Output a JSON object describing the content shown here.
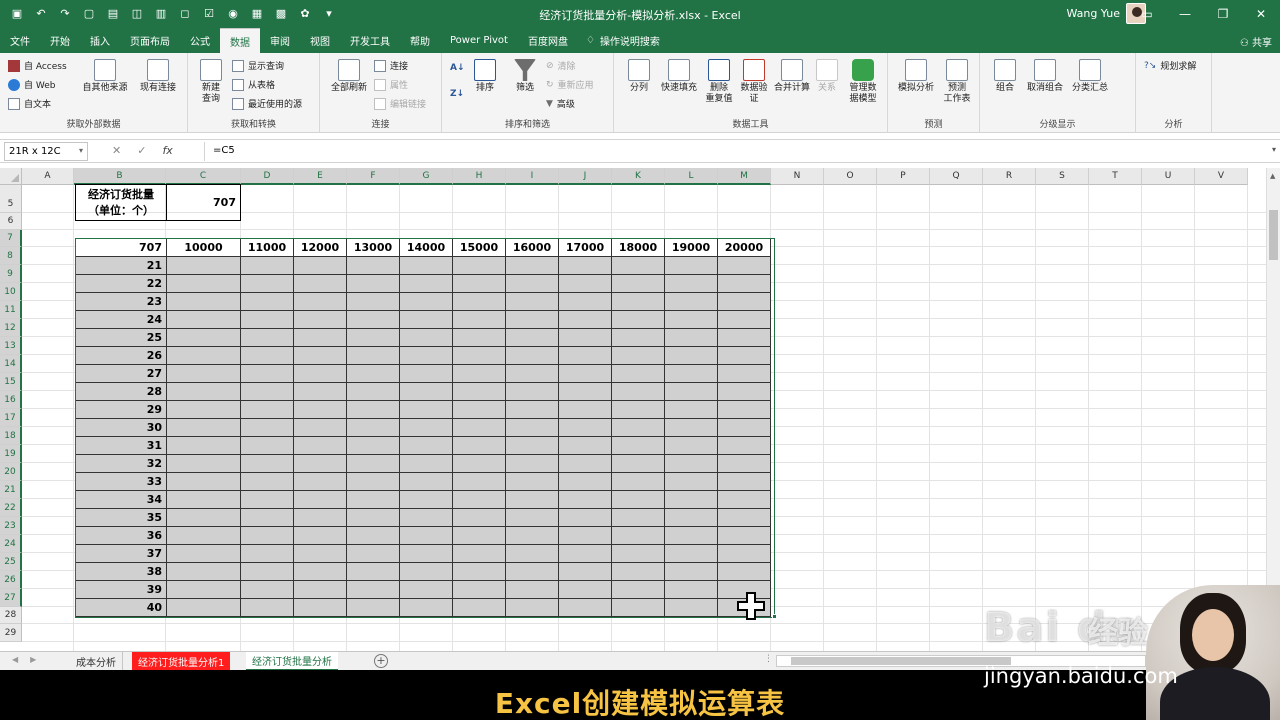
{
  "window": {
    "title": "经济订货批量分析-模拟分析.xlsx  -  Excel",
    "user": "Wang Yue"
  },
  "tabs": [
    "文件",
    "开始",
    "插入",
    "页面布局",
    "公式",
    "数据",
    "审阅",
    "视图",
    "开发工具",
    "帮助",
    "Power Pivot",
    "百度网盘"
  ],
  "active_tab": "数据",
  "tell_me": "操作说明搜索",
  "share": "共享",
  "ribbon": {
    "get_external": {
      "access": "自 Access",
      "web": "自 Web",
      "text": "自文本",
      "other": "自其他来源",
      "existing": "现有连接",
      "label": "获取外部数据"
    },
    "get_transform": {
      "new_query": "新建\n查询",
      "show_query": "显示查询",
      "from_table": "从表格",
      "recent": "最近使用的源",
      "label": "获取和转换"
    },
    "connections": {
      "refresh_all": "全部刷新",
      "connections": "连接",
      "properties": "属性",
      "edit_links": "编辑链接",
      "label": "连接"
    },
    "sort_filter": {
      "sort": "排序",
      "filter": "筛选",
      "clear": "清除",
      "reapply": "重新应用",
      "advanced": "高级",
      "label": "排序和筛选"
    },
    "data_tools": {
      "split": "分列",
      "flash_fill": "快速填充",
      "remove_dup": "删除\n重复值",
      "validation": "数据验\n证",
      "consolidate": "合并计算",
      "relations": "关系",
      "manage_model": "管理数\n据模型",
      "label": "数据工具"
    },
    "forecast": {
      "whatif": "模拟分析",
      "sheet": "预测\n工作表",
      "label": "预测"
    },
    "outline": {
      "group": "组合",
      "ungroup": "取消组合",
      "subtotal": "分类汇总",
      "label": "分级显示"
    },
    "analysis": {
      "solver": "规划求解",
      "label": "分析"
    }
  },
  "formula_bar": {
    "name_box": "21R x 12C",
    "formula": "=C5"
  },
  "columns": [
    "A",
    "B",
    "C",
    "D",
    "E",
    "F",
    "G",
    "H",
    "I",
    "J",
    "K",
    "L",
    "M",
    "N",
    "O",
    "P",
    "Q",
    "R",
    "S",
    "T",
    "U",
    "V"
  ],
  "rows": [
    "5",
    "6",
    "7",
    "8",
    "9",
    "10",
    "11",
    "12",
    "13",
    "14",
    "15",
    "16",
    "17",
    "18",
    "19",
    "20",
    "21",
    "22",
    "23",
    "24",
    "25",
    "26",
    "27",
    "28",
    "29"
  ],
  "label_cell": {
    "line1": "经济订货批量",
    "line2": "（单位：个）"
  },
  "value_cell": "707",
  "table": {
    "corner": "707",
    "col_headers": [
      "10000",
      "11000",
      "12000",
      "13000",
      "14000",
      "15000",
      "16000",
      "17000",
      "18000",
      "19000",
      "20000"
    ],
    "row_headers": [
      "21",
      "22",
      "23",
      "24",
      "25",
      "26",
      "27",
      "28",
      "29",
      "30",
      "31",
      "32",
      "33",
      "34",
      "35",
      "36",
      "37",
      "38",
      "39",
      "40"
    ]
  },
  "sheet_tabs": [
    "成本分析",
    "经济订货批量分析1",
    "经济订货批量分析"
  ],
  "caption": "Excel创建模拟运算表",
  "watermark": {
    "logo": "Bai du",
    "cn": "经验",
    "url": "jingyan.baidu.com"
  }
}
